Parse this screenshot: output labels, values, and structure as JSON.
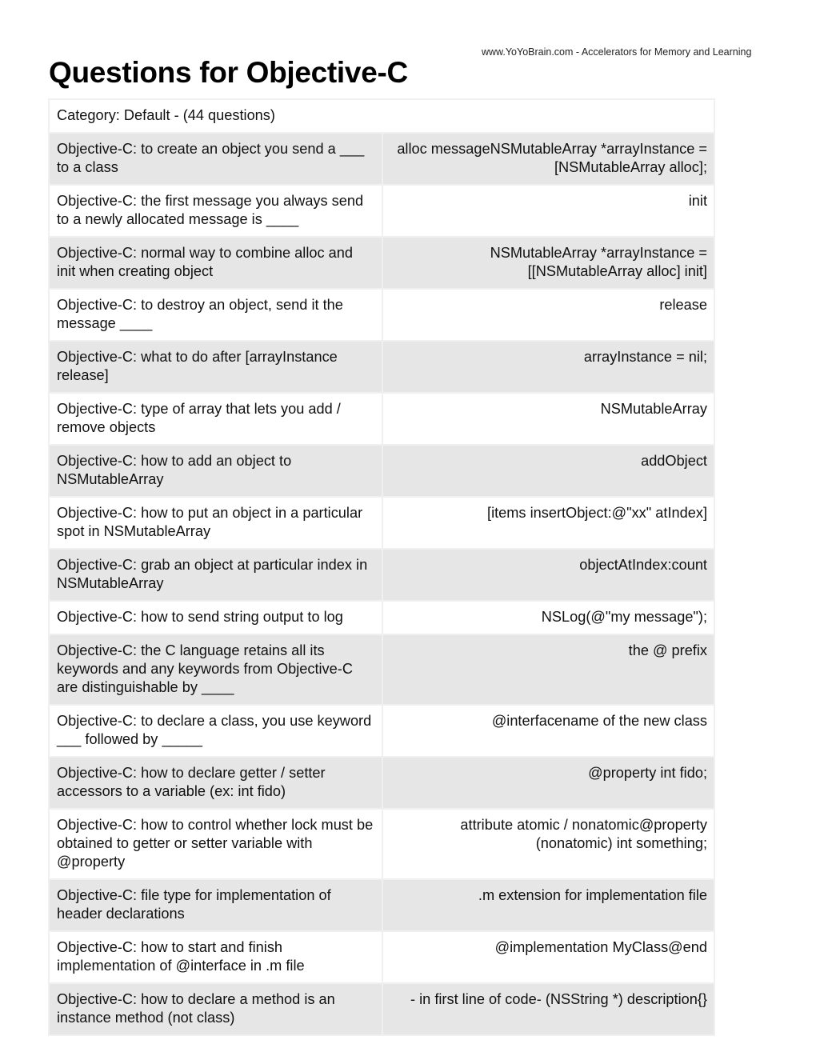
{
  "header": {
    "site_credit": "www.YoYoBrain.com - Accelerators for Memory and Learning",
    "title": "Questions for Objective-C"
  },
  "category": "Category: Default - (44 questions)",
  "rows": [
    {
      "q": "Objective-C:  to create an object you send a ___ to a class",
      "a": "alloc messageNSMutableArray *arrayInstance = [NSMutableArray alloc];"
    },
    {
      "q": "Objective-C:  the first message you always send to a newly allocated message is ____",
      "a": "init"
    },
    {
      "q": "Objective-C:  normal way to combine alloc and init when creating object",
      "a": "NSMutableArray *arrayInstance = [[NSMutableArray alloc] init]"
    },
    {
      "q": "Objective-C:  to destroy an object, send it the message ____",
      "a": "release"
    },
    {
      "q": "Objective-C:  what to do after [arrayInstance release]",
      "a": "arrayInstance = nil;"
    },
    {
      "q": "Objective-C:  type of array that lets you add / remove objects",
      "a": "NSMutableArray"
    },
    {
      "q": "Objective-C:  how to add an object to NSMutableArray",
      "a": "addObject"
    },
    {
      "q": "Objective-C: how to put an object in a particular spot in NSMutableArray",
      "a": "[items insertObject:@\"xx\" atIndex]"
    },
    {
      "q": "Objective-C:  grab an object at particular index in NSMutableArray",
      "a": "objectAtIndex:count"
    },
    {
      "q": "Objective-C:  how to send string output to log",
      "a": "NSLog(@\"my message\");"
    },
    {
      "q": "Objective-C:  the C language retains all its keywords and any keywords from Objective-C are distinguishable by ____",
      "a": "the @ prefix"
    },
    {
      "q": "Objective-C:  to declare a class, you use keyword ___ followed by _____",
      "a": "@interfacename of the new class"
    },
    {
      "q": "Objective-C:  how to declare getter / setter accessors to a variable (ex:  int fido)",
      "a": "@property int fido;"
    },
    {
      "q": "Objective-C:  how to control whether lock must be obtained to getter or setter variable with @property",
      "a": "attribute atomic / nonatomic@property (nonatomic) int something;"
    },
    {
      "q": "Objective-C:  file type for implementation of header declarations",
      "a": ".m extension for implementation file"
    },
    {
      "q": "Objective-C:  how to start and finish implementation of @interface in .m file",
      "a": "@implementation MyClass@end"
    },
    {
      "q": "Objective-C:  how to declare a method is an instance method (not class)",
      "a": "- in first line of code- (NSString *) description{}"
    }
  ]
}
